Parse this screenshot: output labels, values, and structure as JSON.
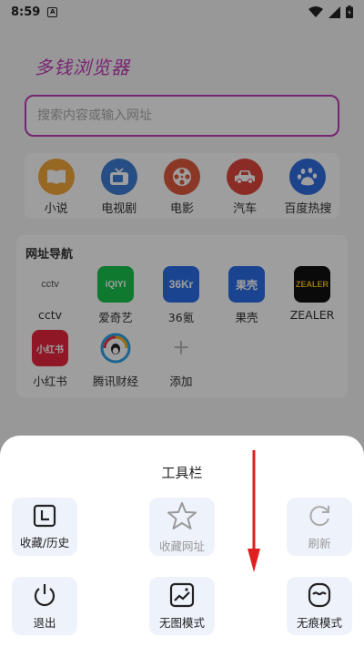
{
  "status_bar": {
    "time": "8:59",
    "notification_icon": "A"
  },
  "browser": {
    "title": "多钱浏览器",
    "search_placeholder": "搜索内容或输入网址",
    "quick_links": [
      {
        "label": "小说",
        "icon": "book-icon",
        "color": "#f2a93b"
      },
      {
        "label": "电视剧",
        "icon": "tv-icon",
        "color": "#3f7fd6"
      },
      {
        "label": "电影",
        "icon": "film-reel-icon",
        "color": "#e05a3c"
      },
      {
        "label": "汽车",
        "icon": "car-icon",
        "color": "#e0463c"
      },
      {
        "label": "百度热搜",
        "icon": "baidu-paw-icon",
        "color": "#2f6fe0"
      }
    ],
    "nav_title": "网址导航",
    "sites": [
      {
        "name": "cctv",
        "logo_text": "cctv",
        "color": "#ffffff"
      },
      {
        "name": "爱奇艺",
        "logo_text": "iQIYI",
        "color": "#19c34e"
      },
      {
        "name": "36氪",
        "logo_text": "36Kr",
        "color": "#2b6fe8"
      },
      {
        "name": "果壳",
        "logo_text": "果壳",
        "color": "#2b6fe8"
      },
      {
        "name": "ZEALER",
        "logo_text": "ZEALER",
        "color": "#111111"
      },
      {
        "name": "小红书",
        "logo_text": "小红书",
        "color": "#e8263e"
      },
      {
        "name": "腾讯财经",
        "logo_text": "",
        "color": "#ffffff"
      },
      {
        "name": "添加",
        "logo_text": "+",
        "color": "#ffffff"
      }
    ]
  },
  "toolbar": {
    "title": "工具栏",
    "items": [
      {
        "label": "收藏/历史",
        "icon": "bookmark-history-icon",
        "enabled": true
      },
      {
        "label": "收藏网址",
        "icon": "star-icon",
        "enabled": false
      },
      {
        "label": "刷新",
        "icon": "refresh-icon",
        "enabled": false
      },
      {
        "label": "退出",
        "icon": "power-icon",
        "enabled": true
      },
      {
        "label": "无图模式",
        "icon": "no-image-icon",
        "enabled": true
      },
      {
        "label": "无痕模式",
        "icon": "incognito-mask-icon",
        "enabled": true
      }
    ]
  },
  "annotation": {
    "arrow_color": "#e02020",
    "direction": "down"
  }
}
